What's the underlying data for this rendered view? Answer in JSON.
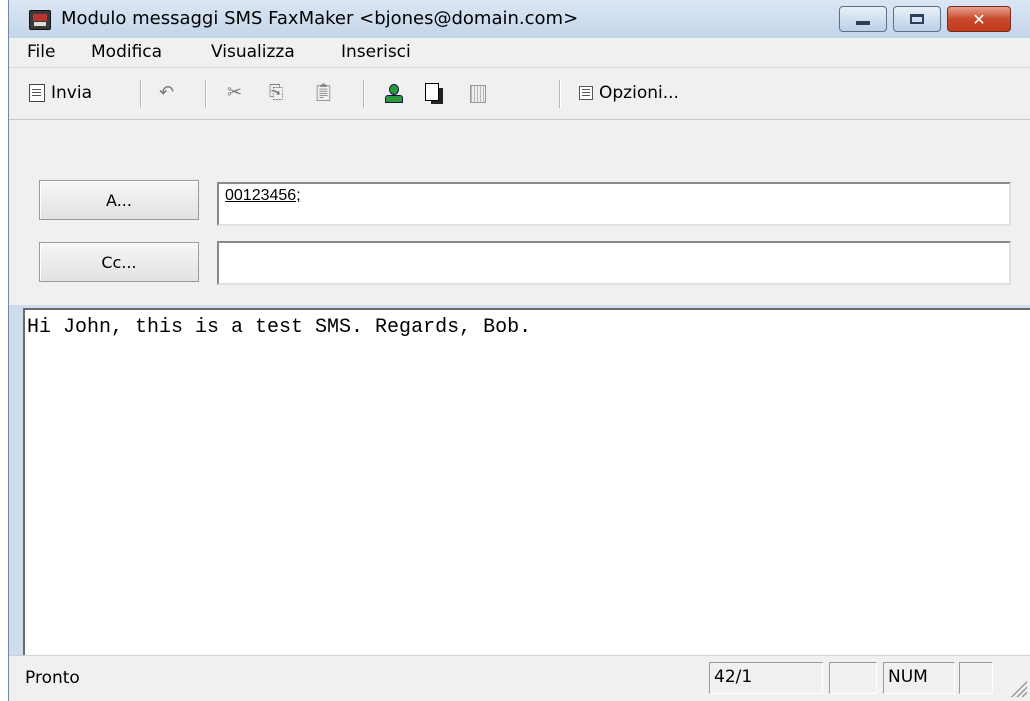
{
  "window": {
    "title": "Modulo messaggi SMS FaxMaker <bjones@domain.com>",
    "app_icon": "fax-machine-icon"
  },
  "menu": {
    "items": [
      "File",
      "Modifica",
      "Visualizza",
      "Inserisci"
    ]
  },
  "toolbar": {
    "send_label": "Invia",
    "options_label": "Opzioni...",
    "icons": [
      "send-doc-icon",
      "undo-icon",
      "cut-icon",
      "copy-icon",
      "paste-icon",
      "user-icon",
      "address-book-icon",
      "book-icon",
      "options-icon"
    ]
  },
  "fields": {
    "to_button": "A...",
    "to_value": "00123456;",
    "cc_button": "Cc...",
    "cc_value": ""
  },
  "message": {
    "body": "Hi John, this is a test SMS. Regards, Bob."
  },
  "status": {
    "text": "Pronto",
    "position": "42/1",
    "num": "NUM"
  },
  "colors": {
    "close_button": "#c84a2c",
    "title_bar": "#c3d5ea"
  }
}
